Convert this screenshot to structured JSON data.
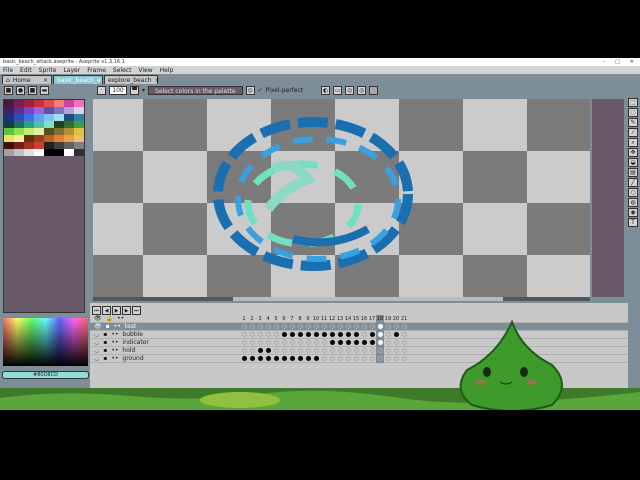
{
  "window": {
    "title": "basic_beach_attack.aseprite - Aseprite v1.3.16.1",
    "controls": [
      "–",
      "□",
      "✕"
    ]
  },
  "menu": [
    "File",
    "Edit",
    "Sprite",
    "Layer",
    "Frame",
    "Select",
    "View",
    "Help"
  ],
  "tabs": [
    {
      "label": "Home",
      "icon": "home-icon"
    },
    {
      "label": "basic_beach_a",
      "active": true
    },
    {
      "label": "explore_beach"
    }
  ],
  "toolbar": {
    "zoom_value": "100",
    "hint": "Select colors in the palette",
    "pixel_perfect": "Pixel-perfect"
  },
  "colors": {
    "accent": "#8dc9d3",
    "panel": "#7d8e98",
    "dark": "#6a5968",
    "fg_color": "#80d8cd"
  },
  "color_hex": "#80D8CD",
  "palette": [
    "#4a1a3a",
    "#7a1f4f",
    "#a02040",
    "#c83040",
    "#e05050",
    "#f08080",
    "#d040a0",
    "#f070c0",
    "#402060",
    "#603090",
    "#8040c0",
    "#a060e0",
    "#6050a0",
    "#8070c0",
    "#b0a0e0",
    "#e0d0f0",
    "#203080",
    "#3050b0",
    "#4070e0",
    "#60a0f0",
    "#80c0f0",
    "#a0e0f0",
    "#205070",
    "#3080a0",
    "#104040",
    "#207060",
    "#30a080",
    "#50c0a0",
    "#80e0c0",
    "#204020",
    "#307030",
    "#40a040",
    "#60c040",
    "#90e050",
    "#c0f070",
    "#e0f0a0",
    "#505020",
    "#807030",
    "#b09030",
    "#e0c040",
    "#f0e060",
    "#f0f0a0",
    "#603010",
    "#904020",
    "#c06020",
    "#e08030",
    "#f0a040",
    "#f0c070",
    "#401010",
    "#702020",
    "#a03020",
    "#d04030",
    "#202020",
    "#404040",
    "#606060",
    "#808080",
    "#a0a0a0",
    "#c0c0c0",
    "#e0e0e0",
    "#ffffff",
    "#000000",
    "#000000",
    "#ffffff",
    "#303030"
  ],
  "timeline": {
    "controls": [
      "first-frame",
      "prev-frame",
      "play",
      "next-frame",
      "last-frame"
    ],
    "frames": [
      "1",
      "2",
      "3",
      "4",
      "5",
      "6",
      "7",
      "8",
      "9",
      "10",
      "11",
      "12",
      "13",
      "14",
      "15",
      "16",
      "17",
      "18",
      "19",
      "20",
      "21"
    ],
    "current_frame": 18,
    "layers": [
      {
        "name": "test",
        "selected": true,
        "cels": []
      },
      {
        "name": "bubble",
        "cels": [
          6,
          7,
          8,
          9,
          10,
          11,
          12,
          13,
          14,
          15,
          17,
          20
        ]
      },
      {
        "name": "indicator",
        "cels": [
          12,
          13,
          14,
          15,
          16,
          17
        ]
      },
      {
        "name": "hold",
        "cels": [
          3,
          4
        ]
      },
      {
        "name": "ground",
        "cels": [
          1,
          2,
          3,
          4,
          5,
          6,
          7,
          8,
          9,
          10
        ]
      }
    ]
  },
  "tools": [
    "marquee",
    "lasso",
    "pencil",
    "eyedropper",
    "zoom",
    "move",
    "bucket",
    "gradient",
    "line",
    "ellipse",
    "contour",
    "blur",
    "text"
  ]
}
